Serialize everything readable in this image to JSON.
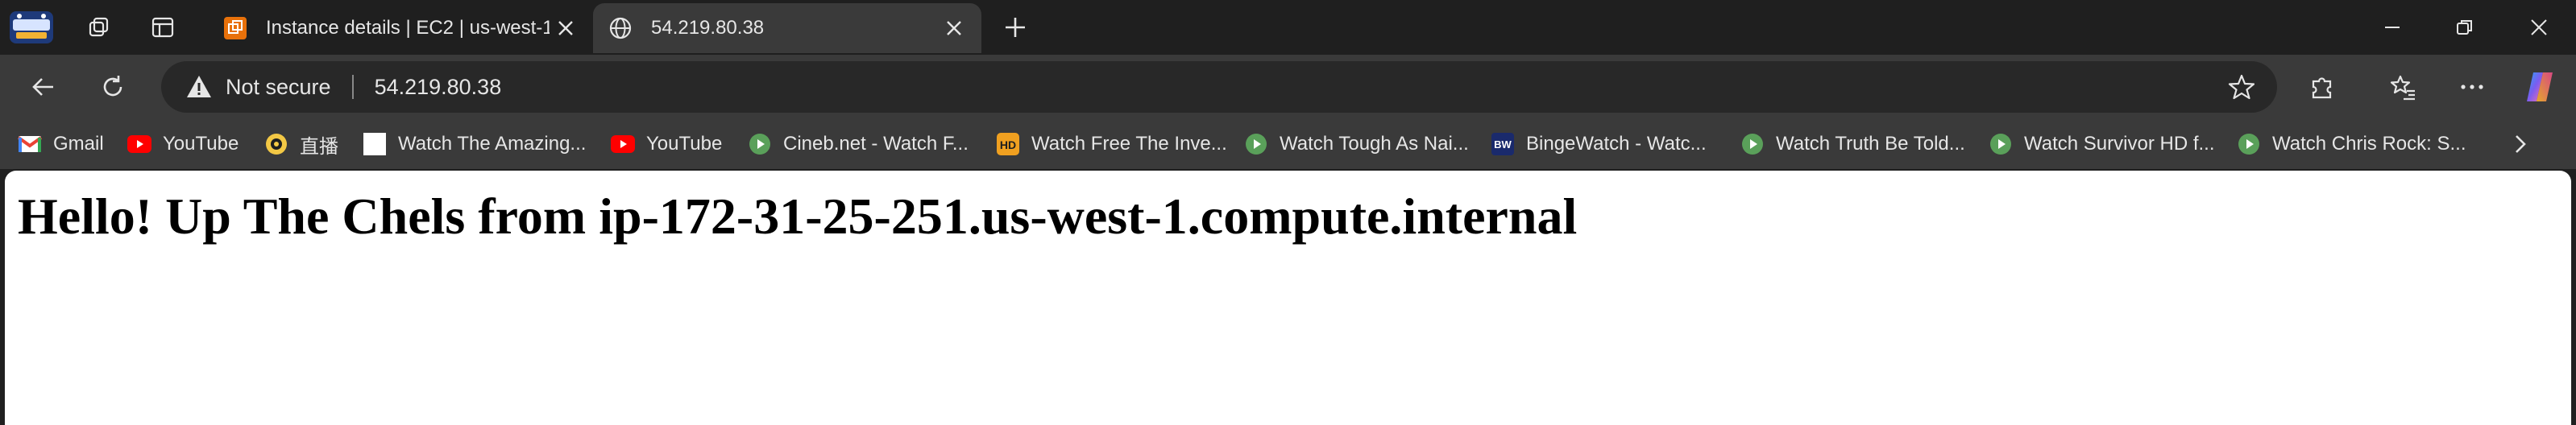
{
  "tabs": [
    {
      "title": "Instance details | EC2 | us-west-1",
      "favicon": "aws-ec2-icon",
      "active": false
    },
    {
      "title": "54.219.80.38",
      "favicon": "globe-icon",
      "active": true
    }
  ],
  "toolbar": {
    "security_label": "Not secure",
    "url": "54.219.80.38"
  },
  "bookmarks": [
    {
      "label": "Gmail",
      "icon": "gmail-icon"
    },
    {
      "label": "YouTube",
      "icon": "youtube-icon"
    },
    {
      "label": "直播",
      "icon": "live-icon"
    },
    {
      "label": "Watch The Amazing...",
      "icon": "blank-page-icon"
    },
    {
      "label": "YouTube",
      "icon": "youtube-icon"
    },
    {
      "label": "Cineb.net - Watch F...",
      "icon": "play-circle-icon"
    },
    {
      "label": "Watch Free The Inve...",
      "icon": "hd-icon"
    },
    {
      "label": "Watch Tough As Nai...",
      "icon": "play-circle-icon"
    },
    {
      "label": "BingeWatch - Watc...",
      "icon": "bw-icon"
    },
    {
      "label": "Watch Truth Be Told...",
      "icon": "play-circle-icon"
    },
    {
      "label": "Watch Survivor HD f...",
      "icon": "play-circle-icon"
    },
    {
      "label": "Watch Chris Rock: S...",
      "icon": "play-circle-icon"
    }
  ],
  "page": {
    "heading": "Hello! Up The Chels from ip-172-31-25-251.us-west-1.compute.internal"
  },
  "colors": {
    "tabstrip_bg": "#1f1f1f",
    "toolbar_bg": "#3a3a3a",
    "omnibox_bg": "#282828",
    "page_bg": "#ffffff",
    "aws_orange": "#e8710a",
    "youtube_red": "#ff0000",
    "play_green": "#5aa05a"
  }
}
